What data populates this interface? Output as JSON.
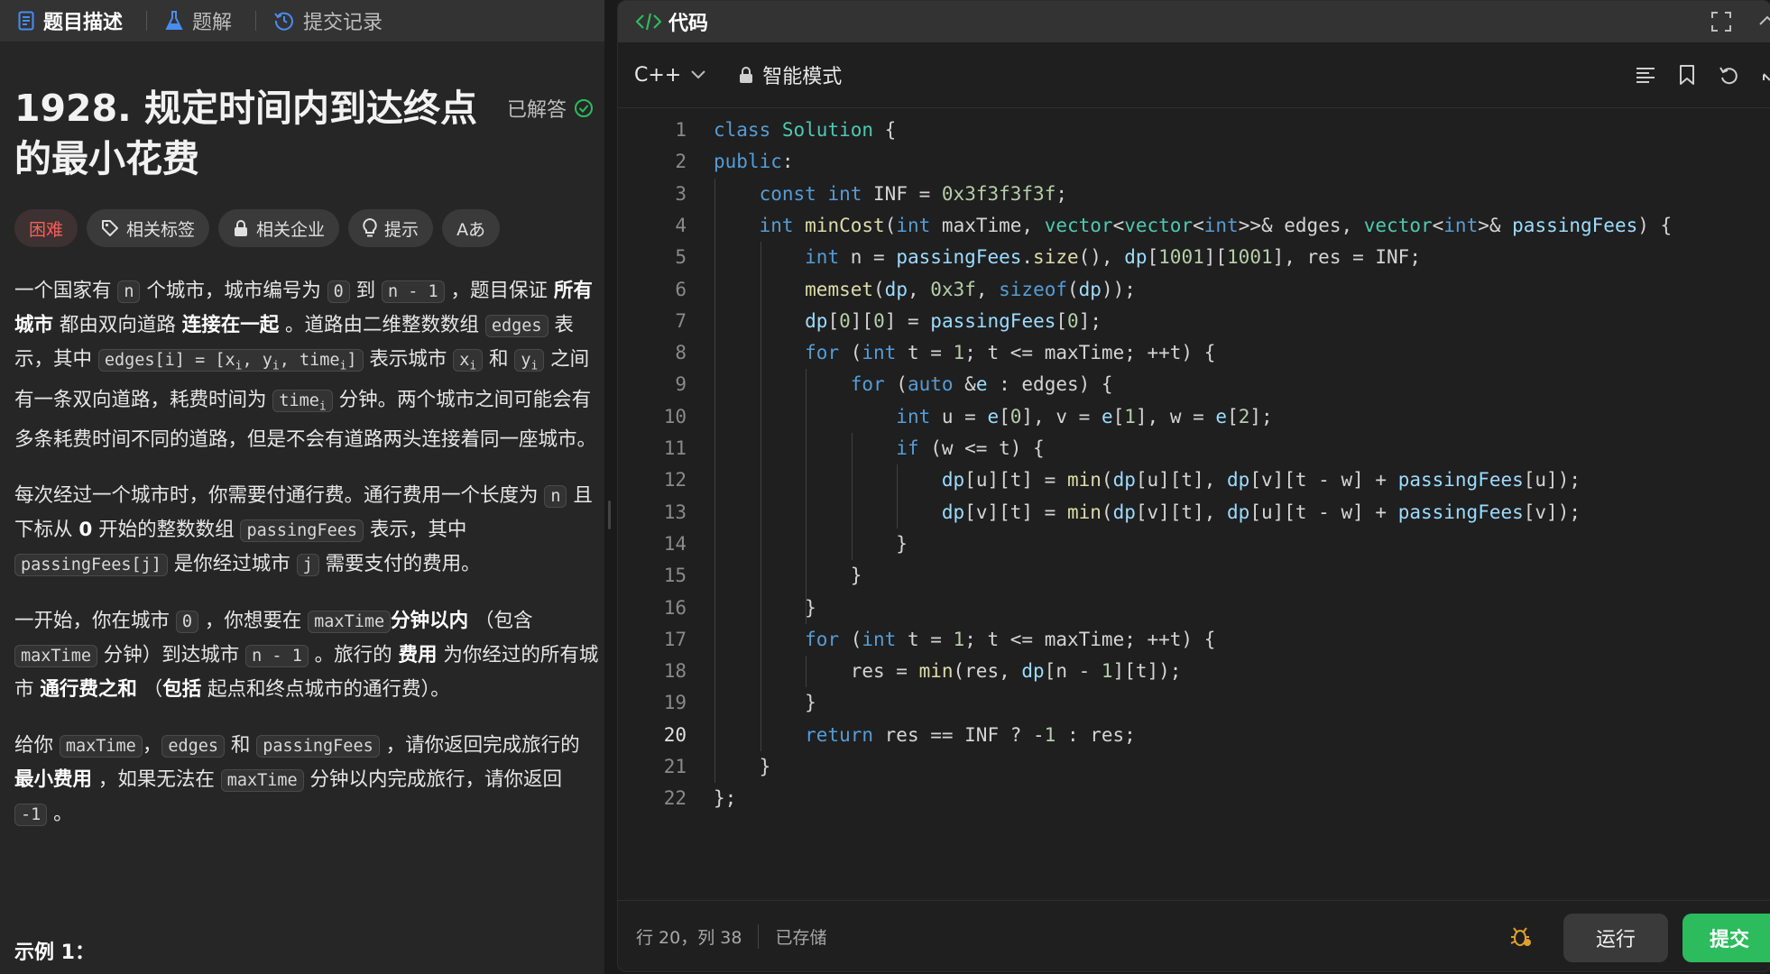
{
  "left_tabs": [
    {
      "label": "题目描述",
      "icon": "document-icon",
      "active": true
    },
    {
      "label": "题解",
      "icon": "flask-icon",
      "active": false
    },
    {
      "label": "提交记录",
      "icon": "history-icon",
      "active": false
    }
  ],
  "problem": {
    "title": "1928. 规定时间内到达终点的最小花费",
    "status": "已解答",
    "tags": [
      "困难",
      "相关标签",
      "相关企业",
      "提示",
      "Aあ"
    ],
    "difficulty_color": "#f5605a",
    "p1": {
      "a": "一个国家有 ",
      "n": "n",
      "b": " 个城市，城市编号为 ",
      "zero": "0",
      "c": " 到 ",
      "nm1": "n - 1",
      "d": " ，题目保证 ",
      "e": "所有城市",
      "f": " 都由双向道路 ",
      "g": "连接在一起",
      "h": " 。道路由二维整数数组 ",
      "edges": "edges",
      "i": " 表示，其中 ",
      "edges_i": "edges[i] = [x",
      "sub_i1": "i",
      "comma1": ", y",
      "sub_i2": "i",
      "comma2": ", time",
      "sub_i3": "i",
      "close": "]",
      "j": " 表示城市 ",
      "x": "x",
      "sub_x": "i",
      "k": " 和 ",
      "y": "y",
      "sub_y": "i",
      "l": " 之间有一条双向道路，耗费时间为 ",
      "time": "time",
      "sub_t": "i",
      "m": " 分钟。两个城市之间可能会有多条耗费时间不同的道路，但是不会有道路两头连接着同一座城市。"
    },
    "p2": {
      "a": "每次经过一个城市时，你需要付通行费。通行费用一个长度为 ",
      "n": "n",
      "b": " 且下标从 ",
      "zero": "0",
      "c": " 开始的整数数组 ",
      "pf": "passingFees",
      "d": " 表示，其中 ",
      "pfj": "passingFees[j]",
      "e": " 是你经过城市 ",
      "j": "j",
      "f": " 需要支付的费用。"
    },
    "p3": {
      "a": "一开始，你在城市 ",
      "zero": "0",
      "b": " ，你想要在 ",
      "mt": "maxTime",
      "c": "分钟以内",
      "d": " （包含 ",
      "mt2": "maxTime",
      "e": " 分钟）到达城市 ",
      "nm1": "n - 1",
      "f": " 。旅行的 ",
      "g": "费用",
      "h": " 为你经过的所有城市 ",
      "i": "通行费之和",
      "j": " （",
      "k": "包括",
      "l": " 起点和终点城市的通行费）。"
    },
    "p4": {
      "a": "给你 ",
      "mt": "maxTime",
      "b": "，",
      "edges": "edges",
      "c": " 和 ",
      "pf": "passingFees",
      "d": " ，请你返回完成旅行的 ",
      "e": "最小费用",
      "f": " ，如果无法在 ",
      "mt2": "maxTime",
      "g": " 分钟以内完成旅行，请你返回 ",
      "neg": "-1",
      "h": " 。"
    },
    "example_heading": "示例 1："
  },
  "editor": {
    "panel_title": "代码",
    "language": "C++",
    "mode": "智能模式",
    "current_line": 20,
    "code_lines": [
      "class Solution {",
      "public:",
      "    const int INF = 0x3f3f3f3f;",
      "    int minCost(int maxTime, vector<vector<int>>& edges, vector<int>& passingFees) {",
      "        int n = passingFees.size(), dp[1001][1001], res = INF;",
      "        memset(dp, 0x3f, sizeof(dp));",
      "        dp[0][0] = passingFees[0];",
      "        for (int t = 1; t <= maxTime; ++t) {",
      "            for (auto &e : edges) {",
      "                int u = e[0], v = e[1], w = e[2];",
      "                if (w <= t) {",
      "                    dp[u][t] = min(dp[u][t], dp[v][t - w] + passingFees[u]);",
      "                    dp[v][t] = min(dp[v][t], dp[u][t - w] + passingFees[v]);",
      "                }",
      "            }",
      "        }",
      "        for (int t = 1; t <= maxTime; ++t) {",
      "            res = min(res, dp[n - 1][t]);",
      "        }",
      "        return res == INF ? -1 : res;",
      "    }",
      "};"
    ]
  },
  "status_bar": {
    "cursor": "行 20，列 38",
    "saved": "已存储",
    "run_label": "运行",
    "submit_label": "提交",
    "submit_color": "#2cbb5d"
  }
}
